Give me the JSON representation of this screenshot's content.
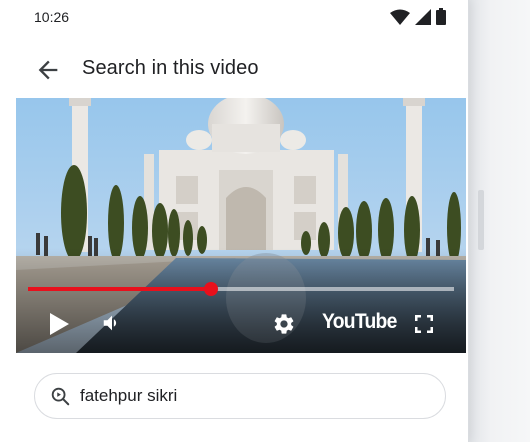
{
  "status_bar": {
    "time": "10:26",
    "icons": [
      "wifi-icon",
      "signal-icon",
      "battery-icon"
    ]
  },
  "app_bar": {
    "title": "Search in this video",
    "back_icon": "arrow-back-icon"
  },
  "video": {
    "progress_fraction": 0.43,
    "controls": [
      "play-icon",
      "volume-icon",
      "settings-gear-icon",
      "fullscreen-icon"
    ],
    "brand": "YouTube",
    "accent_color": "#e8101c"
  },
  "search": {
    "query": "fatehpur sikri",
    "icon": "search-icon"
  }
}
